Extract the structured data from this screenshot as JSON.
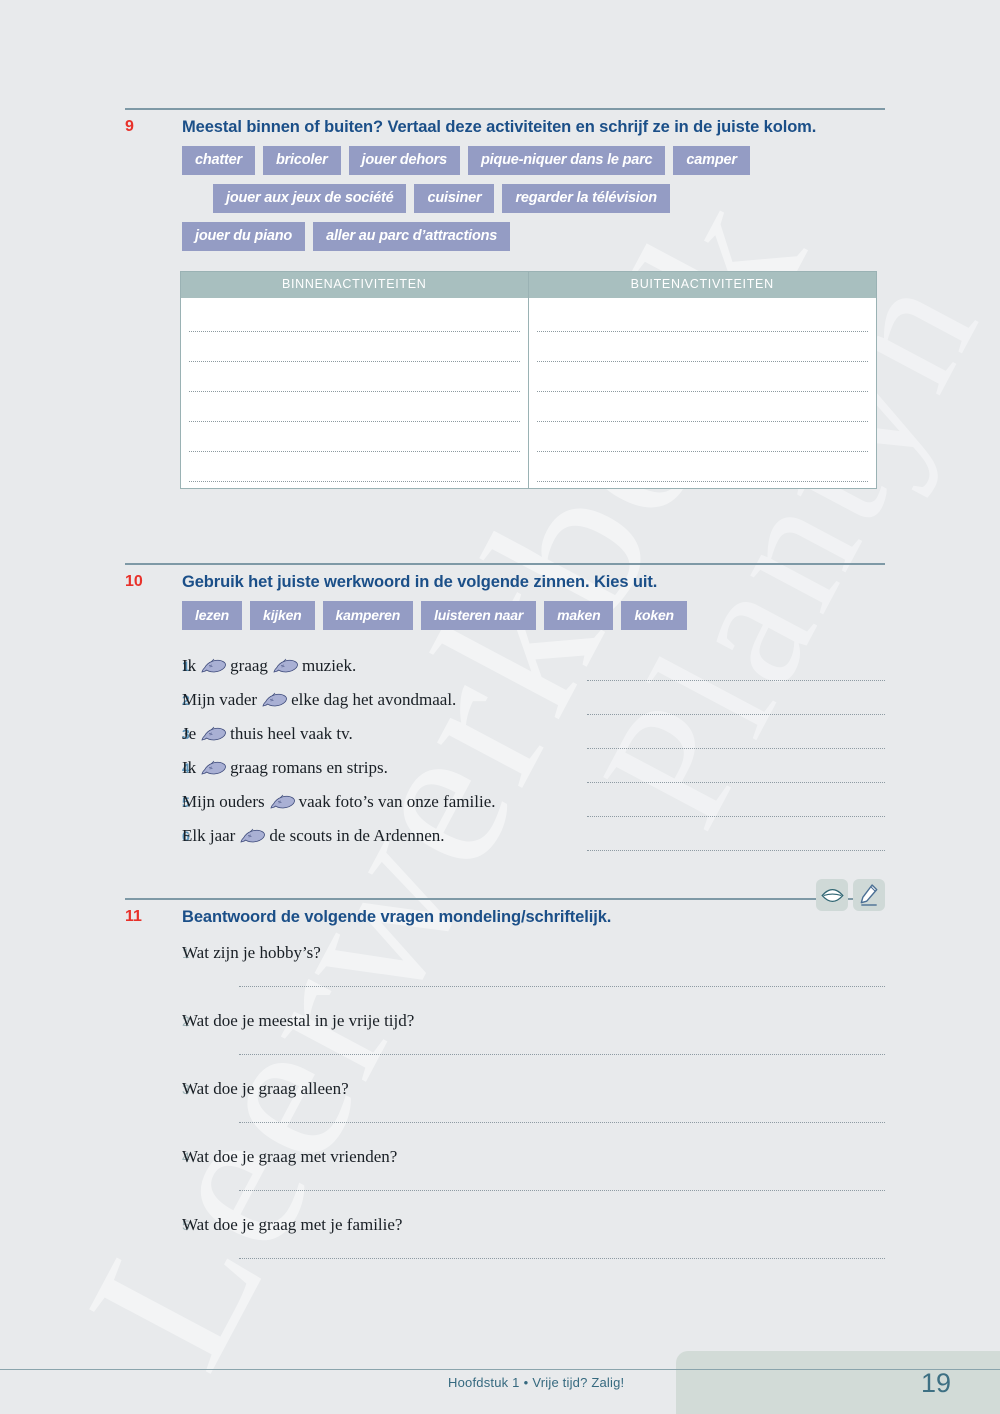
{
  "exercise9": {
    "number": "9",
    "title": "Meestal binnen of buiten? Vertaal deze activiteiten en schrijf ze in de juiste kolom.",
    "chips_row1": [
      "chatter",
      "bricoler",
      "jouer dehors",
      "pique-niquer dans le parc",
      "camper"
    ],
    "chips_row2": [
      "jouer aux jeux de société",
      "cuisiner",
      "regarder la télévision"
    ],
    "chips_row3": [
      "jouer du piano",
      "aller au parc d’attractions"
    ],
    "table": {
      "headers": [
        "BINNENACTIVITEITEN",
        "BUITENACTIVITEITEN"
      ],
      "rows_per_column": 6
    }
  },
  "exercise10": {
    "number": "10",
    "title": "Gebruik het juiste werkwoord in de volgende zinnen. Kies uit.",
    "chips": [
      "lezen",
      "kijken",
      "kamperen",
      "luisteren naar",
      "maken",
      "koken"
    ],
    "sentences": [
      {
        "num": "1",
        "parts": [
          "Ik",
          "graag",
          "muziek."
        ],
        "blanks": 2
      },
      {
        "num": "2",
        "parts": [
          "Mijn vader",
          "elke dag het avondmaal."
        ],
        "blanks": 1
      },
      {
        "num": "3",
        "parts": [
          "Je",
          "thuis heel vaak tv."
        ],
        "blanks": 1
      },
      {
        "num": "4",
        "parts": [
          "Ik",
          "graag romans en strips."
        ],
        "blanks": 1
      },
      {
        "num": "5",
        "parts": [
          "Mijn ouders",
          "vaak foto’s van onze familie."
        ],
        "blanks": 1
      },
      {
        "num": "6",
        "parts": [
          "Elk jaar",
          "de scouts in de Ardennen."
        ],
        "blanks": 1
      }
    ],
    "answer_line_count": 6
  },
  "exercise11": {
    "number": "11",
    "title": "Beantwoord de volgende vragen mondeling/schriftelijk.",
    "icons": [
      "mouth-speaking-icon",
      "pencil-writing-icon"
    ],
    "questions": [
      {
        "num": "1",
        "text": "Wat zijn je hobby’s?"
      },
      {
        "num": "2",
        "text": "Wat doe je meestal in je vrije tijd?"
      },
      {
        "num": "3",
        "text": "Wat doe je graag alleen?"
      },
      {
        "num": "4",
        "text": "Wat doe je graag met vrienden?"
      },
      {
        "num": "5",
        "text": "Wat doe je graag met je familie?"
      }
    ]
  },
  "footer": {
    "chapter": "Hoofdstuk 1",
    "separator": "•",
    "title": "Vrije tijd? Zalig!",
    "page_number": "19"
  },
  "watermark": {
    "line1": "Leerwerkboek",
    "line2": "Plantyn"
  },
  "colors": {
    "background": "#e8eaec",
    "exercise_number": "#e8312a",
    "heading": "#1b4f88",
    "chip_bg": "#949cc4",
    "table_header_bg": "#a8bfbf",
    "rule": "#7e99a6",
    "footer_text": "#35697f",
    "page_box": "#d2dbd7"
  }
}
